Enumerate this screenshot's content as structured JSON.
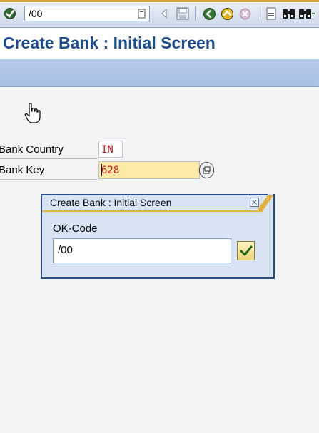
{
  "toolbar": {
    "command_field_value": "/00",
    "icons": [
      "enter-check-icon",
      "command-dropdown-icon",
      "back-arrow-icon",
      "save-icon",
      "back-icon",
      "exit-icon",
      "cancel-icon",
      "print-icon",
      "find-icon",
      "find-next-icon"
    ]
  },
  "header": {
    "title": "Create Bank : Initial Screen"
  },
  "form": {
    "bank_country_label": "Bank Country",
    "bank_country_value": "IN",
    "bank_key_label": "Bank Key",
    "bank_key_value": "628"
  },
  "popup": {
    "title": "Create Bank : Initial Screen",
    "ok_code_label": "OK-Code",
    "ok_code_value": "/00"
  },
  "colors": {
    "title_text": "#1c4e8f",
    "app_toolbar": "#b7cbea",
    "required_field": "#fdeaa6",
    "field_text": "#cc1a1a",
    "popup_bg": "#d8e4f4",
    "popup_accent": "#e0b23c"
  }
}
